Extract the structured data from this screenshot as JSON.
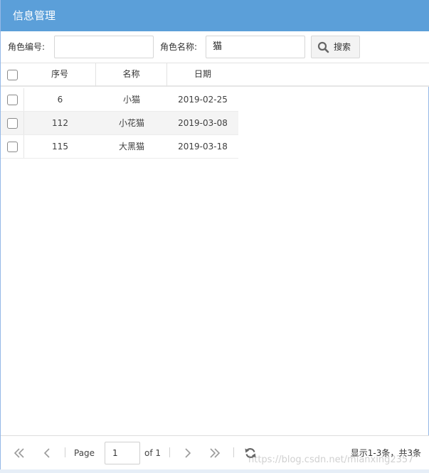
{
  "panel": {
    "title": "信息管理"
  },
  "toolbar": {
    "role_id_label": "角色编号:",
    "role_id_value": "",
    "role_name_label": "角色名称:",
    "role_name_value": "猫",
    "search_label": "搜索"
  },
  "grid": {
    "columns": [
      "序号",
      "名称",
      "日期"
    ],
    "rows": [
      {
        "id": "6",
        "name": "小猫",
        "date": "2019-02-25",
        "checked": false
      },
      {
        "id": "112",
        "name": "小花猫",
        "date": "2019-03-08",
        "checked": false
      },
      {
        "id": "115",
        "name": "大黑猫",
        "date": "2019-03-18",
        "checked": false
      }
    ]
  },
  "pager": {
    "page_label": "Page",
    "page_value": "1",
    "of_label": "of 1",
    "info": "显示1-3条，共3条",
    "icons": [
      "first-page-icon",
      "prev-page-icon",
      "next-page-icon",
      "last-page-icon",
      "refresh-icon"
    ]
  },
  "watermark": "https://blog.csdn.net/mianxing2357",
  "colors": {
    "header": "#5b9fd9",
    "row_alt": "#f4f4f4",
    "border": "#95b8e7"
  }
}
